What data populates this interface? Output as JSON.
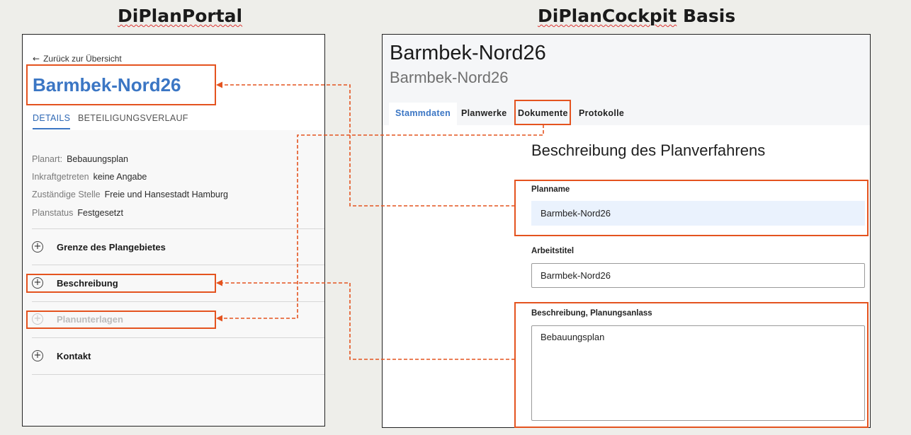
{
  "headings": {
    "portal": "DiPlanPortal",
    "cockpit_squiggly": "DiPlanCockpit",
    "cockpit_plain": "Basis"
  },
  "portal": {
    "back_label": "Zurück zur Übersicht",
    "back_icon": "arrow-left-icon",
    "title": "Barmbek-Nord26",
    "tabs": [
      {
        "label": "DETAILS",
        "active": true
      },
      {
        "label": "BETEILIGUNGSVERLAUF",
        "active": false
      }
    ],
    "meta": [
      {
        "key": "Planart:",
        "value": "Bebauungsplan"
      },
      {
        "key": "Inkraftgetreten",
        "value": "keine Angabe"
      },
      {
        "key": "Zuständige Stelle",
        "value": "Freie und Hansestadt Hamburg"
      },
      {
        "key": "Planstatus",
        "value": "Festgesetzt"
      }
    ],
    "accordion": [
      {
        "label": "Grenze des Plangebietes",
        "disabled": false,
        "icon": "plus-circle-icon"
      },
      {
        "label": "Beschreibung",
        "disabled": false,
        "icon": "plus-circle-icon"
      },
      {
        "label": "Planunterlagen",
        "disabled": true,
        "icon": "plus-circle-icon"
      },
      {
        "label": "Kontakt",
        "disabled": false,
        "icon": "plus-circle-icon"
      }
    ]
  },
  "cockpit": {
    "title": "Barmbek-Nord26",
    "subtitle": "Barmbek-Nord26",
    "tabs": [
      {
        "label": "Stammdaten",
        "active": true
      },
      {
        "label": "Planwerke",
        "active": false
      },
      {
        "label": "Dokumente",
        "active": false
      },
      {
        "label": "Protokolle",
        "active": false
      }
    ],
    "section_title": "Beschreibung des Planverfahrens",
    "fields": {
      "planname": {
        "label": "Planname",
        "value": "Barmbek-Nord26"
      },
      "arbeitstitel": {
        "label": "Arbeitstitel",
        "value": "Barmbek-Nord26"
      },
      "beschreibung": {
        "label": "Beschreibung, Planungsanlass",
        "value": "Bebauungsplan"
      }
    }
  },
  "colors": {
    "annotation": "#e4531f",
    "accent_blue": "#3b76c4",
    "input_fill": "#eaf2fd",
    "page_background": "#eeeeea"
  }
}
